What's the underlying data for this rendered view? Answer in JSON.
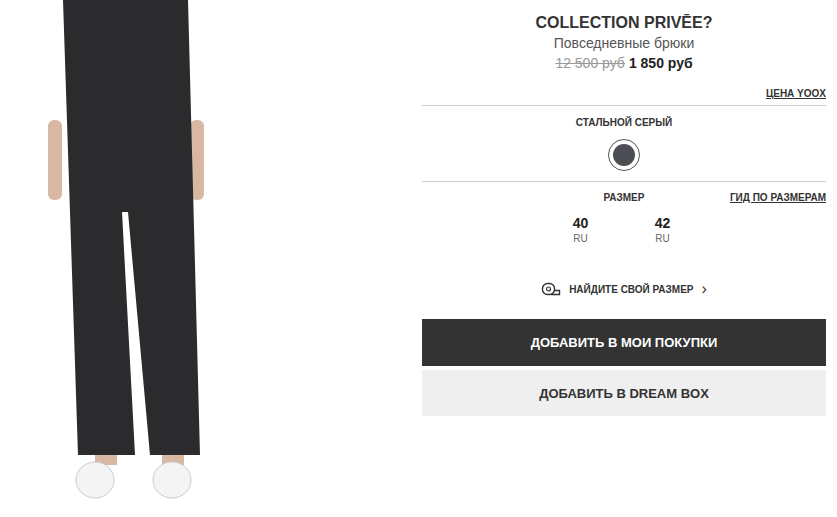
{
  "product": {
    "brand": "COLLECTION PRIVĒE?",
    "type": "Повседневные брюки",
    "old_price": "12 500 руб",
    "price": "1 850 руб",
    "price_note": "ЦЕНА YOOX"
  },
  "color": {
    "label": "СТАЛЬНОЙ СЕРЫЙ",
    "swatches": [
      {
        "selected": true,
        "color": "#4b4e52"
      }
    ]
  },
  "size": {
    "label": "РАЗМЕР",
    "guide": "ГИД ПО РАЗМЕРАМ",
    "options": [
      {
        "value": "40",
        "unit": "RU",
        "selected": false
      },
      {
        "value": "42",
        "unit": "RU",
        "selected": false
      }
    ]
  },
  "find_size": {
    "label": "НАЙДИТЕ СВОЙ РАЗМЕР",
    "chevron": "›"
  },
  "buttons": [
    {
      "label": "ДОБАВИТЬ В МОИ ПОКУПКИ",
      "kind": "primary"
    },
    {
      "label": "ДОБАВИТЬ В DREAM BOX",
      "kind": "secondary"
    }
  ]
}
